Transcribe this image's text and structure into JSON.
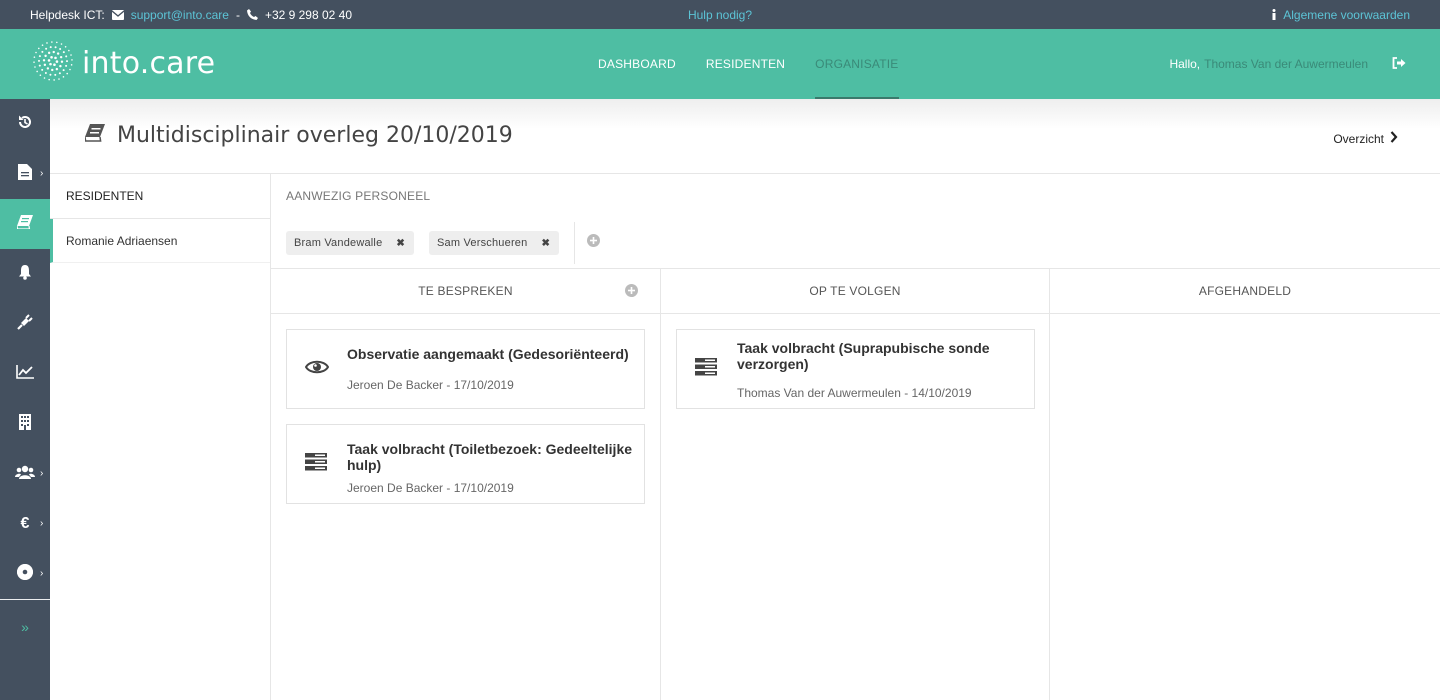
{
  "infobar": {
    "helpdesk_label": "Helpdesk ICT:",
    "email": "support@into.care",
    "separator": "-",
    "phone": "+32 9 298 02 40",
    "help": "Hulp nodig?",
    "terms": "Algemene voorwaarden"
  },
  "header": {
    "logo_text": "into.care",
    "nav": [
      {
        "label": "DASHBOARD"
      },
      {
        "label": "RESIDENTEN"
      },
      {
        "label": "ORGANISATIE"
      }
    ],
    "greeting": "Hallo,",
    "user_name": "Thomas Van der Auwermeulen"
  },
  "page": {
    "title": "Multidisciplinair overleg 20/10/2019",
    "overview_label": "Overzicht"
  },
  "residents": {
    "header": "RESIDENTEN",
    "items": [
      {
        "name": "Romanie Adriaensen"
      }
    ]
  },
  "staff": {
    "label": "AANWEZIG PERSONEEL",
    "members": [
      {
        "name": "Bram Vandewalle"
      },
      {
        "name": "Sam Verschueren"
      }
    ]
  },
  "board": {
    "columns": [
      {
        "title": "TE BESPREKEN",
        "cards": [
          {
            "icon": "eye-icon",
            "title": "Observatie aangemaakt (Gedesoriënteerd)",
            "meta": "Jeroen De Backer - 17/10/2019"
          },
          {
            "icon": "tasks-icon",
            "title": "Taak volbracht (Toiletbezoek: Gedeeltelijke hulp)",
            "meta": "Jeroen De Backer - 17/10/2019"
          }
        ]
      },
      {
        "title": "OP TE VOLGEN",
        "cards": [
          {
            "icon": "tasks-icon",
            "title": "Taak volbracht (Suprapubische sonde verzorgen)",
            "meta": "Thomas Van der Auwermeulen - 14/10/2019"
          }
        ]
      },
      {
        "title": "AFGEHANDELD",
        "cards": []
      }
    ]
  },
  "colors": {
    "brand": "#4ebea3",
    "dark": "#44505f",
    "link": "#5cc4d6"
  }
}
